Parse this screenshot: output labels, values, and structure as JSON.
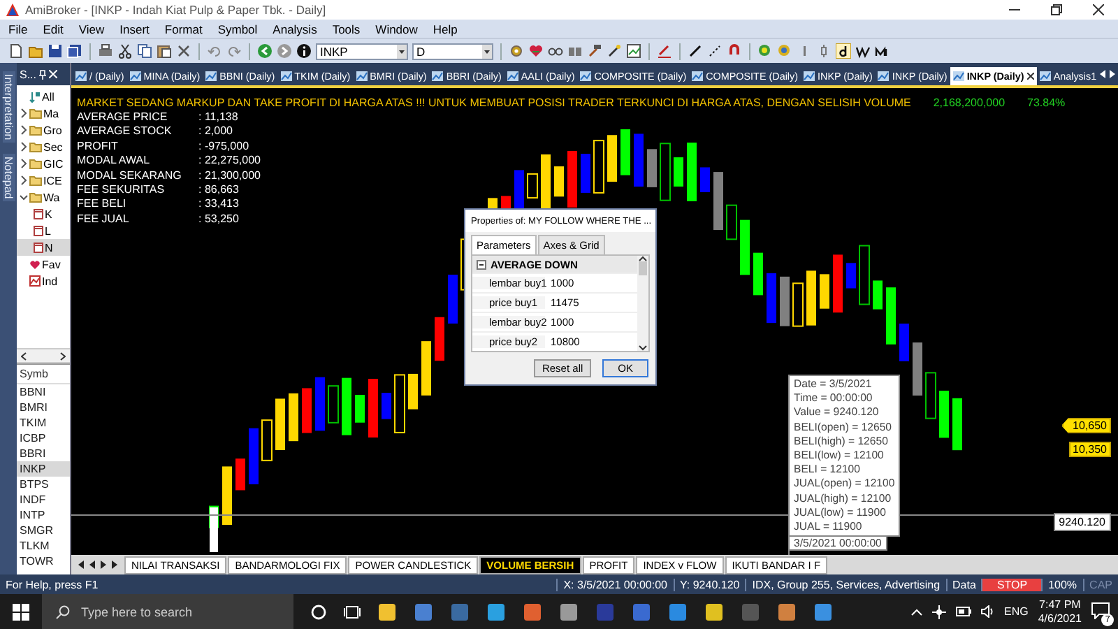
{
  "window": {
    "title": "AmiBroker - [INKP - Indah Kiat Pulp & Paper Tbk. - Daily]"
  },
  "menu": [
    "File",
    "Edit",
    "View",
    "Insert",
    "Format",
    "Symbol",
    "Analysis",
    "Tools",
    "Window",
    "Help"
  ],
  "toolbar": {
    "symbol": "INKP",
    "interval": "D"
  },
  "side_tabs": [
    "Interpretation",
    "Notepad"
  ],
  "symbols_panel": {
    "title": "S...",
    "tree": [
      {
        "label": "All",
        "kind": "all"
      },
      {
        "label": "Ma",
        "kind": "folder",
        "expanded": false
      },
      {
        "label": "Gro",
        "kind": "folder",
        "expanded": false
      },
      {
        "label": "Sec",
        "kind": "folder",
        "expanded": false
      },
      {
        "label": "GIC",
        "kind": "folder",
        "expanded": false
      },
      {
        "label": "ICE",
        "kind": "folder",
        "expanded": false
      },
      {
        "label": "Wa",
        "kind": "folder",
        "expanded": true,
        "children": [
          {
            "label": "K",
            "selected": false
          },
          {
            "label": "L",
            "selected": false
          },
          {
            "label": "N",
            "selected": true
          }
        ]
      },
      {
        "label": "Fav",
        "kind": "favorite"
      },
      {
        "label": "Ind",
        "kind": "indicator"
      }
    ],
    "list_header": "Symb",
    "symbols": [
      {
        "label": "BBNI",
        "selected": false
      },
      {
        "label": "BMRI",
        "selected": false
      },
      {
        "label": "TKIM",
        "selected": false
      },
      {
        "label": "ICBP",
        "selected": false
      },
      {
        "label": "BBRI",
        "selected": false
      },
      {
        "label": "INKP",
        "selected": true
      },
      {
        "label": "BTPS",
        "selected": false
      },
      {
        "label": "INDF",
        "selected": false
      },
      {
        "label": "INTP",
        "selected": false
      },
      {
        "label": "SMGR",
        "selected": false
      },
      {
        "label": "TLKM",
        "selected": false
      },
      {
        "label": "TOWR",
        "selected": false
      }
    ]
  },
  "chart_tabs": [
    {
      "label": "/ (Daily)",
      "selected": false
    },
    {
      "label": "MINA (Daily)",
      "selected": false
    },
    {
      "label": "BBNI (Daily)",
      "selected": false
    },
    {
      "label": "TKIM (Daily)",
      "selected": false
    },
    {
      "label": "BMRI (Daily)",
      "selected": false
    },
    {
      "label": "BBRI (Daily)",
      "selected": false
    },
    {
      "label": "AALI (Daily)",
      "selected": false
    },
    {
      "label": "COMPOSITE (Daily)",
      "selected": false
    },
    {
      "label": "COMPOSITE (Daily)",
      "selected": false
    },
    {
      "label": "INKP (Daily)",
      "selected": false
    },
    {
      "label": "INKP (Daily)",
      "selected": false
    },
    {
      "label": "INKP (Daily)",
      "selected": true
    },
    {
      "label": "Analysis1",
      "selected": false
    }
  ],
  "chart": {
    "headline": "MARKET SEDANG MARKUP DAN TAKE PROFIT DI HARGA ATAS !!! UNTUK MEMBUAT POSISI TRADER TERKUNCI DI HARGA ATAS, DENGAN SELISIH VOLUME",
    "volume": "2,168,200,000",
    "percent": "73.84%",
    "stats": [
      {
        "label": "AVERAGE PRICE",
        "value": ": 11,138"
      },
      {
        "label": "AVERAGE STOCK",
        "value": ": 2,000"
      },
      {
        "label": "PROFIT",
        "value": ": -975,000"
      },
      {
        "label": "MODAL AWAL",
        "value": ": 22,275,000"
      },
      {
        "label": "MODAL SEKARANG",
        "value": ": 21,300,000"
      },
      {
        "label": "FEE SEKURITAS",
        "value": ": 86,663"
      },
      {
        "label": "FEE BELI",
        "value": ": 33,413"
      },
      {
        "label": "FEE JUAL",
        "value": ": 53,250"
      }
    ],
    "price_tags": [
      {
        "text": "10,650",
        "kind": "pointer"
      },
      {
        "text": "10,350",
        "kind": "box"
      }
    ],
    "y_value": "9240.120",
    "x_value": "3/5/2021 00:00:00",
    "tooltip": [
      "Date = 3/5/2021",
      "Time = 00:00:00",
      "Value = 9240.120",
      "BELI(open) = 12650",
      "BELI(high) = 12650",
      "BELI(low) = 12100",
      "BELI = 12100",
      "JUAL(open) = 12100",
      "JUAL(high) = 12100",
      "JUAL(low) = 11900",
      "JUAL = 11900"
    ]
  },
  "dialog": {
    "title": "Properties of: MY FOLLOW WHERE THE ...",
    "tabs": [
      {
        "label": "Parameters",
        "selected": true
      },
      {
        "label": "Axes & Grid",
        "selected": false
      }
    ],
    "section": "AVERAGE DOWN",
    "params": [
      {
        "name": "lembar buy1",
        "value": "1000"
      },
      {
        "name": "price buy1",
        "value": "11475"
      },
      {
        "name": "lembar buy2",
        "value": "1000"
      },
      {
        "name": "price buy2",
        "value": "10800"
      }
    ],
    "buttons": [
      "Reset all",
      "OK"
    ]
  },
  "sheet_tabs": [
    {
      "label": "NILAI TRANSAKSI",
      "selected": false
    },
    {
      "label": "BANDARMOLOGI FIX",
      "selected": false
    },
    {
      "label": "POWER CANDLESTICK",
      "selected": false
    },
    {
      "label": "VOLUME BERSIH",
      "selected": true
    },
    {
      "label": "PROFIT",
      "selected": false
    },
    {
      "label": "INDEX v FLOW",
      "selected": false
    },
    {
      "label": "IKUTI BANDAR I F",
      "selected": false
    }
  ],
  "status_bar": {
    "help": "For Help, press F1",
    "x": "X: 3/5/2021 00:00:00",
    "y": "Y: 9240.120",
    "info": "IDX, Group 255, Services, Advertising",
    "data": "Data",
    "stop": "STOP",
    "zoom": "100%",
    "caps": {
      "label": "CAP",
      "disabled": true
    }
  },
  "taskbar": {
    "search_placeholder": "Type here to search",
    "language": "ENG",
    "time": "7:47 PM",
    "date": "4/6/2021",
    "notifications": "7"
  }
}
